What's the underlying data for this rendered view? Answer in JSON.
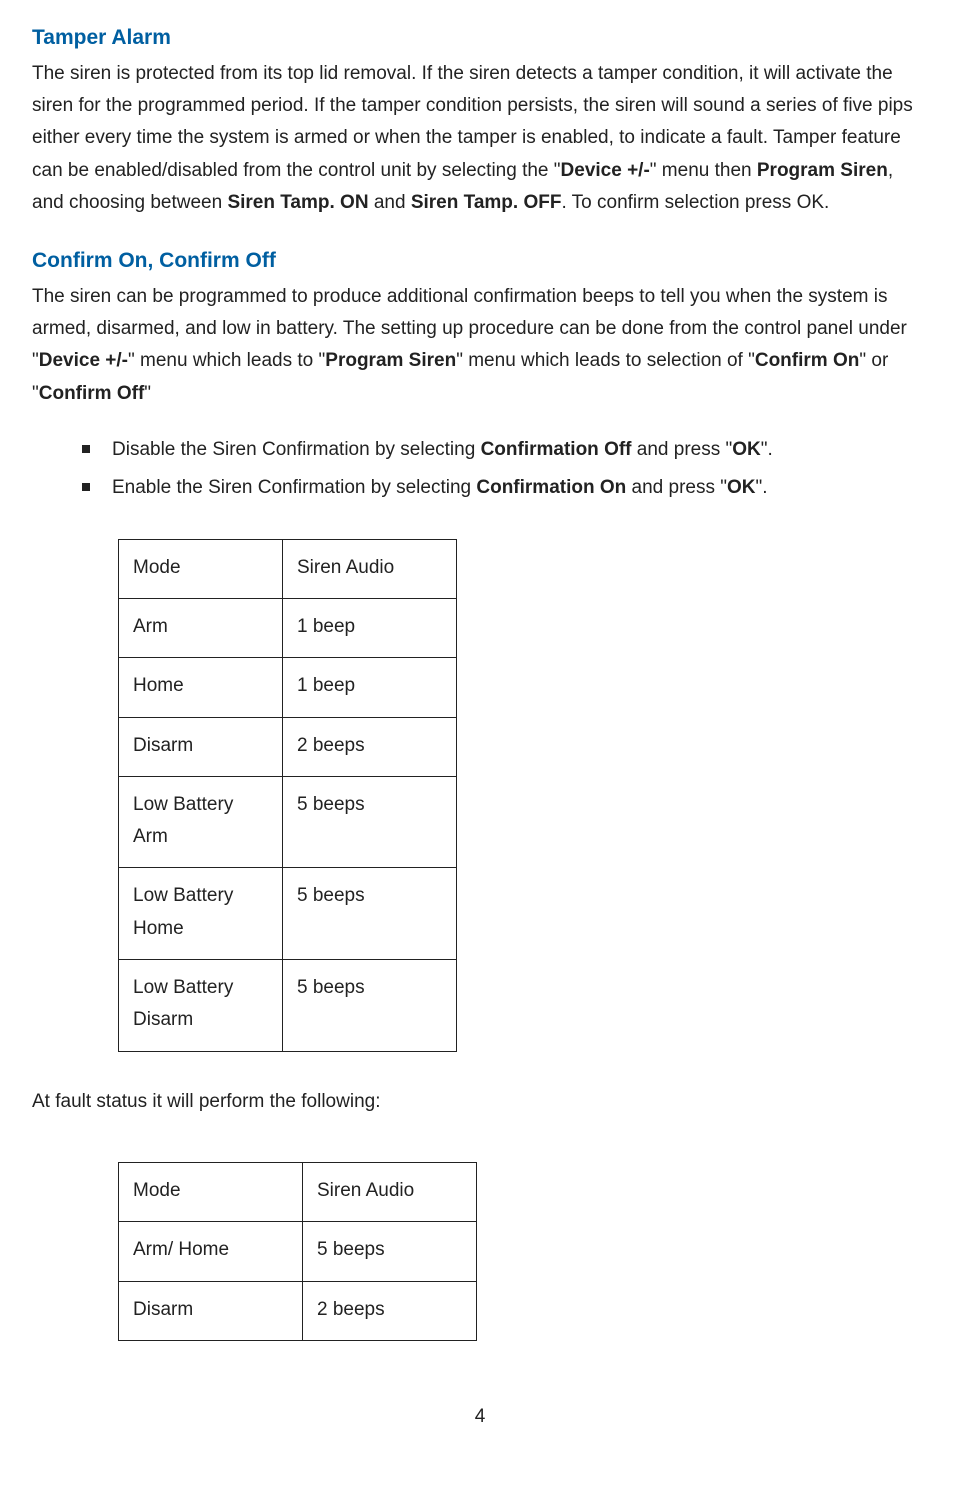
{
  "tamper": {
    "heading": "Tamper Alarm",
    "p1a": "The siren is protected from its top lid removal. If the siren detects a tamper condition, it will activate the siren for the programmed period. If the tamper condition persists, the siren will sound a series of five pips either every time the system is armed or when the tamper is enabled, to indicate a fault. Tamper feature can be enabled/disabled from the control unit by selecting the \"",
    "b1": "Device +/-",
    "p1b": "\" menu then ",
    "b2": "Program Siren",
    "p1c": ", and choosing between ",
    "b3": "Siren Tamp. ON",
    "p1d": " and ",
    "b4": "Siren Tamp. OFF",
    "p1e": ". To confirm selection press OK."
  },
  "confirm": {
    "heading": "Confirm On, Confirm Off",
    "p1a": "The siren can be programmed to produce additional confirmation beeps to tell you when the system is armed, disarmed, and low in battery. The setting up procedure can be done from the control panel under \"",
    "b1": "Device +/-",
    "p1b": "\" menu which leads to \"",
    "b2": "Program Siren",
    "p1c": "\" menu which leads to selection of  \"",
    "b3": "Confirm On",
    "p1d": "\" or \"",
    "b4": "Confirm Off",
    "p1e": "\""
  },
  "bullets": {
    "disable_a": "Disable the Siren Confirmation by selecting ",
    "disable_b1": "Confirmation Off",
    "disable_b": " and press \"",
    "disable_b2": "OK",
    "disable_c": "\".",
    "enable_a": "Enable the Siren Confirmation by selecting ",
    "enable_b1": "Confirmation On",
    "enable_b": " and press \"",
    "enable_b2": "OK",
    "enable_c": "\"."
  },
  "table1": {
    "h1": "Mode",
    "h2": "Siren Audio",
    "r1c1": "Arm",
    "r1c2": "1 beep",
    "r2c1": "Home",
    "r2c2": "1 beep",
    "r3c1": "Disarm",
    "r3c2": "2 beeps",
    "r4c1": "Low Battery Arm",
    "r4c2": "5 beeps",
    "r5c1": "Low Battery Home",
    "r5c2": "5 beeps",
    "r6c1": "Low Battery Disarm",
    "r6c2": "5 beeps"
  },
  "between": "At fault status it will perform the following:",
  "table2": {
    "h1": "Mode",
    "h2": "Siren Audio",
    "r1c1": "Arm/ Home",
    "r1c2": "5 beeps",
    "r2c1": "Disarm",
    "r2c2": "2 beeps"
  },
  "pagenum": "4"
}
